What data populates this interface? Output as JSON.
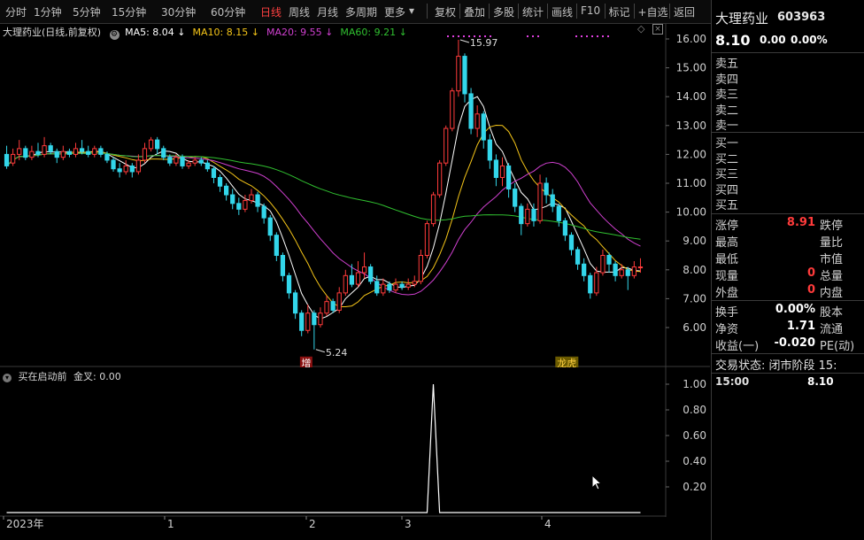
{
  "toolbar": {
    "periods": [
      "分时",
      "1分钟",
      "5分钟",
      "15分钟",
      "30分钟",
      "60分钟",
      "日线",
      "周线",
      "月线",
      "多周期",
      "更多"
    ],
    "active_period": "日线",
    "more_arrow": "▾",
    "tools": [
      "复权",
      "叠加",
      "多股",
      "统计",
      "画线",
      "F10",
      "标记",
      "+自选",
      "返回"
    ]
  },
  "legend": {
    "title": "大理药业(日线,前复权)",
    "settings_icon": "gear-icon",
    "ma": [
      {
        "label": "MA5: 8.04",
        "arrow": "↓",
        "color": "#ffffff"
      },
      {
        "label": "MA10: 8.15",
        "arrow": "↓",
        "color": "#f5c518"
      },
      {
        "label": "MA20: 9.55",
        "arrow": "↓",
        "color": "#d040d0"
      },
      {
        "label": "MA60: 9.21",
        "arrow": "↓",
        "color": "#30c030"
      }
    ]
  },
  "annotations": {
    "high": "15.97",
    "low": "5.24",
    "sign_zeng": "增",
    "sign_dragon": "龙虎"
  },
  "indicator": {
    "name": "买在启动前",
    "line": "金叉: 0.00"
  },
  "colors": {
    "up": "#ff3b3b",
    "down": "#33d6ea",
    "ma5": "#ffffff",
    "ma10": "#f5c518",
    "ma20": "#d040d0",
    "ma60": "#30c030",
    "dots": "#e040e0"
  },
  "chart_data": [
    {
      "type": "candlestick",
      "title": "大理药业(日线,前复权)",
      "y_ticks": [
        16.0,
        15.0,
        14.0,
        13.0,
        12.0,
        11.0,
        10.0,
        9.0,
        8.0,
        7.0,
        6.0
      ],
      "ylim": [
        5.0,
        16.3
      ],
      "x_labels": [
        "2023年",
        "1",
        "2",
        "3",
        "4"
      ],
      "grid": false,
      "annotations": [
        {
          "label": "15.97",
          "value": 15.97
        },
        {
          "label": "5.24",
          "value": 5.24
        }
      ],
      "candles": [
        [
          12.0,
          11.6,
          12.3,
          11.5
        ],
        [
          11.7,
          12.0,
          12.2,
          11.6
        ],
        [
          12.0,
          12.2,
          12.5,
          11.8
        ],
        [
          12.2,
          11.9,
          12.3,
          11.8
        ],
        [
          11.9,
          12.1,
          12.3,
          11.8
        ],
        [
          12.1,
          12.0,
          12.4,
          11.9
        ],
        [
          12.0,
          12.3,
          12.6,
          11.9
        ],
        [
          12.3,
          12.1,
          12.4,
          12.0
        ],
        [
          12.1,
          11.9,
          12.2,
          11.7
        ],
        [
          11.9,
          12.1,
          12.3,
          11.8
        ],
        [
          12.1,
          12.0,
          12.2,
          11.9
        ],
        [
          12.0,
          12.2,
          12.4,
          11.9
        ],
        [
          12.2,
          12.1,
          12.5,
          12.0
        ],
        [
          12.1,
          12.0,
          12.3,
          11.9
        ],
        [
          12.0,
          12.2,
          12.3,
          11.9
        ],
        [
          12.2,
          12.0,
          12.3,
          11.9
        ],
        [
          12.0,
          11.8,
          12.1,
          11.7
        ],
        [
          11.8,
          11.5,
          11.9,
          11.4
        ],
        [
          11.5,
          11.4,
          11.7,
          11.2
        ],
        [
          11.4,
          11.6,
          11.8,
          11.3
        ],
        [
          11.6,
          11.4,
          11.7,
          11.2
        ],
        [
          11.4,
          11.8,
          12.0,
          11.3
        ],
        [
          11.8,
          12.2,
          12.4,
          11.7
        ],
        [
          12.2,
          12.5,
          12.6,
          12.1
        ],
        [
          12.5,
          12.2,
          12.6,
          12.0
        ],
        [
          12.2,
          11.9,
          12.3,
          11.8
        ],
        [
          11.9,
          11.7,
          12.0,
          11.6
        ],
        [
          11.7,
          11.9,
          12.0,
          11.6
        ],
        [
          11.9,
          11.6,
          12.0,
          11.5
        ],
        [
          11.6,
          11.7,
          11.8,
          11.5
        ],
        [
          11.7,
          11.8,
          11.9,
          11.6
        ],
        [
          11.8,
          11.7,
          11.9,
          11.6
        ],
        [
          11.7,
          11.5,
          11.8,
          11.4
        ],
        [
          11.5,
          11.2,
          11.6,
          11.0
        ],
        [
          11.2,
          10.9,
          11.3,
          10.7
        ],
        [
          10.9,
          10.6,
          11.0,
          10.4
        ],
        [
          10.6,
          10.3,
          10.8,
          10.1
        ],
        [
          10.3,
          10.1,
          10.5,
          9.9
        ],
        [
          10.1,
          10.4,
          10.6,
          10.0
        ],
        [
          10.4,
          10.6,
          10.8,
          10.3
        ],
        [
          10.6,
          10.2,
          10.7,
          10.0
        ],
        [
          10.2,
          9.8,
          10.3,
          9.6
        ],
        [
          9.8,
          9.2,
          9.9,
          9.0
        ],
        [
          9.2,
          8.5,
          9.3,
          8.3
        ],
        [
          8.5,
          7.8,
          8.6,
          7.6
        ],
        [
          7.8,
          7.2,
          7.9,
          7.0
        ],
        [
          7.2,
          6.5,
          7.3,
          6.3
        ],
        [
          6.5,
          5.9,
          6.6,
          5.7
        ],
        [
          5.9,
          6.5,
          6.8,
          5.8
        ],
        [
          6.5,
          6.1,
          6.6,
          5.24
        ],
        [
          6.1,
          6.5,
          6.7,
          6.0
        ],
        [
          6.5,
          6.9,
          7.1,
          6.4
        ],
        [
          6.9,
          6.6,
          7.0,
          6.5
        ],
        [
          6.6,
          7.2,
          7.4,
          6.5
        ],
        [
          7.2,
          7.8,
          8.0,
          7.1
        ],
        [
          7.8,
          7.5,
          8.2,
          7.4
        ],
        [
          7.5,
          7.9,
          8.3,
          7.4
        ],
        [
          7.9,
          8.1,
          8.6,
          7.7
        ],
        [
          8.1,
          7.6,
          8.2,
          7.5
        ],
        [
          7.6,
          7.2,
          7.8,
          7.1
        ],
        [
          7.2,
          7.5,
          7.7,
          7.1
        ],
        [
          7.5,
          7.3,
          7.6,
          7.2
        ],
        [
          7.3,
          7.5,
          7.7,
          7.2
        ],
        [
          7.5,
          7.4,
          7.6,
          7.3
        ],
        [
          7.4,
          7.5,
          7.7,
          7.3
        ],
        [
          7.5,
          7.6,
          7.8,
          7.4
        ],
        [
          7.6,
          8.5,
          8.7,
          7.5
        ],
        [
          8.5,
          9.6,
          9.7,
          8.4
        ],
        [
          9.6,
          10.6,
          10.7,
          9.5
        ],
        [
          10.6,
          11.7,
          11.8,
          10.5
        ],
        [
          11.7,
          12.9,
          13.0,
          11.6
        ],
        [
          12.9,
          14.2,
          14.3,
          12.8
        ],
        [
          14.2,
          15.4,
          15.97,
          14.0
        ],
        [
          15.4,
          14.1,
          15.5,
          13.8
        ],
        [
          14.1,
          12.9,
          14.3,
          12.7
        ],
        [
          12.9,
          13.4,
          13.7,
          12.6
        ],
        [
          13.4,
          12.5,
          13.5,
          12.2
        ],
        [
          12.5,
          11.8,
          12.7,
          11.5
        ],
        [
          11.8,
          11.2,
          12.0,
          10.9
        ],
        [
          11.2,
          11.6,
          11.9,
          10.9
        ],
        [
          11.6,
          10.8,
          11.7,
          10.5
        ],
        [
          10.8,
          10.2,
          11.0,
          10.0
        ],
        [
          10.2,
          9.6,
          10.3,
          9.2
        ],
        [
          9.6,
          10.1,
          10.3,
          9.5
        ],
        [
          10.1,
          9.7,
          10.3,
          9.5
        ],
        [
          9.7,
          11.0,
          11.3,
          9.6
        ],
        [
          11.0,
          10.6,
          11.2,
          10.3
        ],
        [
          10.6,
          10.2,
          10.8,
          10.0
        ],
        [
          10.2,
          9.7,
          10.3,
          9.5
        ],
        [
          9.7,
          9.2,
          9.8,
          9.0
        ],
        [
          9.2,
          8.7,
          9.3,
          8.5
        ],
        [
          8.7,
          8.2,
          8.8,
          8.0
        ],
        [
          8.2,
          7.8,
          8.4,
          7.6
        ],
        [
          7.8,
          7.2,
          7.9,
          7.0
        ],
        [
          7.2,
          7.9,
          8.1,
          7.1
        ],
        [
          7.9,
          8.5,
          8.7,
          7.8
        ],
        [
          8.5,
          8.2,
          8.6,
          7.9
        ],
        [
          8.2,
          7.8,
          8.3,
          7.6
        ],
        [
          7.8,
          8.0,
          8.2,
          7.7
        ],
        [
          8.0,
          7.8,
          8.1,
          7.3
        ],
        [
          7.8,
          8.1,
          8.3,
          7.7
        ],
        [
          8.1,
          8.1,
          8.4,
          7.9
        ]
      ],
      "series": [
        {
          "name": "MA5"
        },
        {
          "name": "MA10"
        },
        {
          "name": "MA20"
        },
        {
          "name": "MA60"
        }
      ]
    },
    {
      "type": "line",
      "title": "买在启动前",
      "y_ticks": [
        1.0,
        0.8,
        0.6,
        0.4,
        0.2
      ],
      "ylim": [
        0,
        1.05
      ],
      "spike_index": 68,
      "spike_value": 1.0
    }
  ],
  "right_panel": {
    "stock_name": "大理药业",
    "stock_code": "603963",
    "price": "8.10",
    "change": "0.00",
    "change_pct": "0.00%",
    "sell_levels": [
      "卖五",
      "卖四",
      "卖三",
      "卖二",
      "卖一"
    ],
    "buy_levels": [
      "买一",
      "买二",
      "买三",
      "买四",
      "买五"
    ],
    "stats": [
      {
        "label": "涨停",
        "value": "8.91",
        "value_color": "#ff3b3b",
        "label2": "跌停"
      },
      {
        "label": "最高",
        "value": "",
        "value_color": "#ffffff",
        "label2": "量比"
      },
      {
        "label": "最低",
        "value": "",
        "value_color": "#ffffff",
        "label2": "市值"
      },
      {
        "label": "现量",
        "value": "0",
        "value_color": "#ff3b3b",
        "label2": "总量"
      },
      {
        "label": "外盘",
        "value": "0",
        "value_color": "#ff3b3b",
        "label2": "内盘"
      }
    ],
    "stats2": [
      {
        "label": "换手",
        "value": "0.00%",
        "label2": "股本"
      },
      {
        "label": "净资",
        "value": "1.71",
        "label2": "流通"
      },
      {
        "label": "收益(一)",
        "value": "-0.020",
        "label2": "PE(动)"
      }
    ],
    "trade_status": "交易状态: 闭市阶段 15:",
    "tick_time": "15:00",
    "tick_price": "8.10"
  }
}
